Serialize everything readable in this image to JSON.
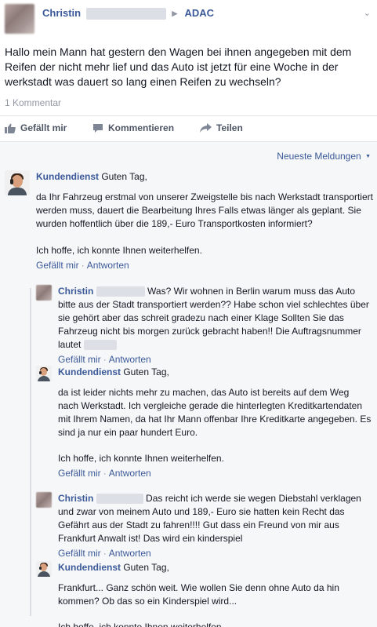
{
  "post": {
    "author": "Christin",
    "target": "ADAC",
    "text": "Hallo mein Mann hat gestern den Wagen bei ihnen angegeben mit dem Reifen der nicht mehr lief und das Auto ist jetzt für eine Woche in der werkstadt was dauert so lang einen Reifen zu wechseln?",
    "comment_count": "1 Kommentar"
  },
  "actions": {
    "like": "Gefällt mir",
    "comment": "Kommentieren",
    "share": "Teilen"
  },
  "comments": {
    "sort_label": "Neueste Meldungen",
    "like_label": "Gefällt mir",
    "reply_label": "Antworten",
    "c1": {
      "name": "Kundendienst",
      "greeting": "Guten Tag,",
      "p1": "da Ihr Fahrzeug erstmal von unserer Zweigstelle bis nach Werkstadt transportiert werden muss, dauert die Bearbeitung Ihres Falls etwas länger als geplant. Sie wurden hoffentlich über die 189,- Euro Transportkosten informiert?",
      "p2": "Ich hoffe, ich konnte Ihnen weiterhelfen."
    },
    "r1": {
      "name": "Christin",
      "text": "Was? Wir wohnen in Berlin warum muss das Auto bitte aus der Stadt transportiert werden?? Habe schon viel schlechtes über sie gehört aber das schreit gradezu nach einer Klage Sollten Sie das Fahrzeug nicht bis morgen zurück gebracht haben!! Die Auftragsnummer lautet"
    },
    "r2": {
      "name": "Kundendienst",
      "greeting": "Guten Tag,",
      "p1": "da ist leider nichts mehr zu machen, das Auto ist bereits auf dem Weg nach Werkstadt. Ich vergleiche gerade die hinterlegten Kreditkartendaten mit Ihrem Namen, da hat Ihr Mann offenbar Ihre Kreditkarte angegeben. Es sind ja nur ein paar hundert Euro.",
      "p2": "Ich hoffe, ich konnte Ihnen weiterhelfen."
    },
    "r3": {
      "name": "Christin",
      "text": "Das reicht ich werde sie wegen Diebstahl verklagen und zwar von meinem Auto und 189,- Euro sie hatten kein Recht das Gefährt aus der Stadt zu fahren!!!! Gut dass ein Freund von mir aus Frankfurt Anwalt ist! Das wird ein kinderspiel"
    },
    "r4": {
      "name": "Kundendienst",
      "greeting": "Guten Tag,",
      "p1": "Frankfurt... Ganz schön weit. Wie wollen Sie denn ohne Auto da hin kommen? Ob das so ein Kinderspiel wird...",
      "p2": "Ich hoffe, ich konnte Ihnen weiterhelfen."
    }
  }
}
